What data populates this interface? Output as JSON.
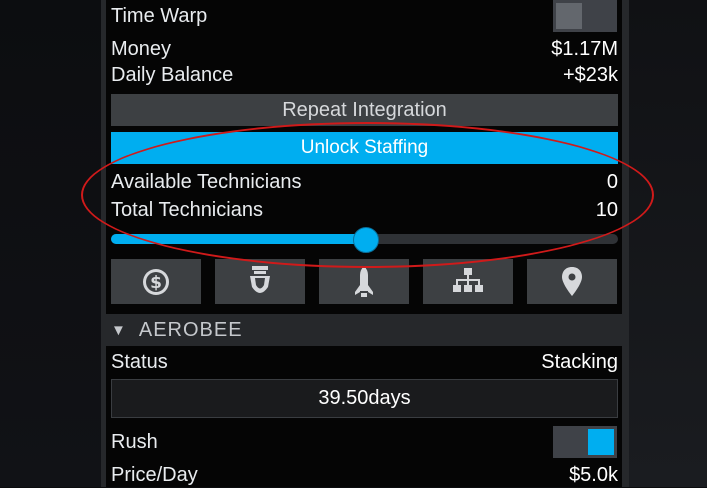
{
  "settings": {
    "time_warp_label": "Time Warp",
    "time_warp_on": false,
    "money_label": "Money",
    "money_value": "$1.17M",
    "daily_balance_label": "Daily Balance",
    "daily_balance_value": "+$23k"
  },
  "buttons": {
    "repeat_integration": "Repeat Integration",
    "unlock_staffing": "Unlock Staffing"
  },
  "technicians": {
    "available_label": "Available Technicians",
    "available_value": "0",
    "total_label": "Total Technicians",
    "total_value": "10",
    "slider_fraction": 0.5
  },
  "icon_bar": [
    "dollar-icon",
    "engine-nozzle-icon",
    "rocket-icon",
    "hierarchy-icon",
    "location-pin-icon"
  ],
  "section": {
    "chevron_glyph": "▼",
    "title": "AEROBEE",
    "status_label": "Status",
    "status_value": "Stacking",
    "duration": "39.50days",
    "rush_label": "Rush",
    "rush_on": true,
    "price_label": "Price/Day",
    "price_value": "$5.0k"
  },
  "colors": {
    "accent": "#00aef0",
    "panel": "#26282b",
    "button": "#3d4043",
    "annotation": "#d01a1a"
  }
}
